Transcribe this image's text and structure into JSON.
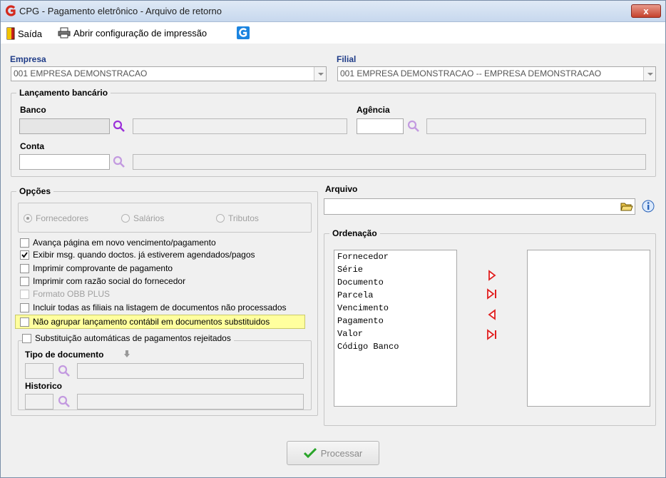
{
  "window": {
    "title": "CPG - Pagamento eletrônico - Arquivo de retorno",
    "close": "x"
  },
  "toolbar": {
    "exit_label": "Saída",
    "print_config_label": "Abrir configuração de impressão"
  },
  "empresa": {
    "label": "Empresa",
    "value": "001 EMPRESA DEMONSTRACAO"
  },
  "filial": {
    "label": "Filial",
    "value": "001 EMPRESA DEMONSTRACAO -- EMPRESA DEMONSTRACAO"
  },
  "lancamento": {
    "title": "Lançamento bancário",
    "banco_label": "Banco",
    "agencia_label": "Agência",
    "conta_label": "Conta"
  },
  "opcoes": {
    "title": "Opções",
    "radios": [
      {
        "label": "Fornecedores",
        "selected": true
      },
      {
        "label": "Salários",
        "selected": false
      },
      {
        "label": "Tributos",
        "selected": false
      }
    ],
    "checkboxes": [
      {
        "label": "Avança página em novo vencimento/pagamento",
        "checked": false,
        "enabled": true
      },
      {
        "label": "Exibir msg. quando doctos. já estiverem agendados/pagos",
        "checked": true,
        "enabled": true
      },
      {
        "label": "Imprimir comprovante de pagamento",
        "checked": false,
        "enabled": true
      },
      {
        "label": "Imprimir com razão social do fornecedor",
        "checked": false,
        "enabled": true
      },
      {
        "label": "Formato OBB PLUS",
        "checked": false,
        "enabled": false
      },
      {
        "label": "Incluir todas as filiais na listagem de documentos não processados",
        "checked": false,
        "enabled": true
      },
      {
        "label": "Não agrupar lançamento contábil em documentos substituidos",
        "checked": false,
        "enabled": true
      }
    ],
    "substituicao_label": "Substituição automáticas de pagamentos rejeitados",
    "tipo_documento_label": "Tipo de documento",
    "historico_label": "Historico"
  },
  "arquivo": {
    "label": "Arquivo",
    "value": ""
  },
  "ordenacao": {
    "title": "Ordenação",
    "available": [
      "Fornecedor",
      "Série",
      "Documento",
      "Parcela",
      "Vencimento",
      "Pagamento",
      "Valor",
      "Código Banco"
    ],
    "selected": []
  },
  "actions": {
    "process_label": "Processar"
  },
  "colors": {
    "label_blue": "#1f3c88",
    "magnifier": "#9b30d9",
    "arrow_red": "#e02020",
    "check_green": "#2aa52a"
  }
}
